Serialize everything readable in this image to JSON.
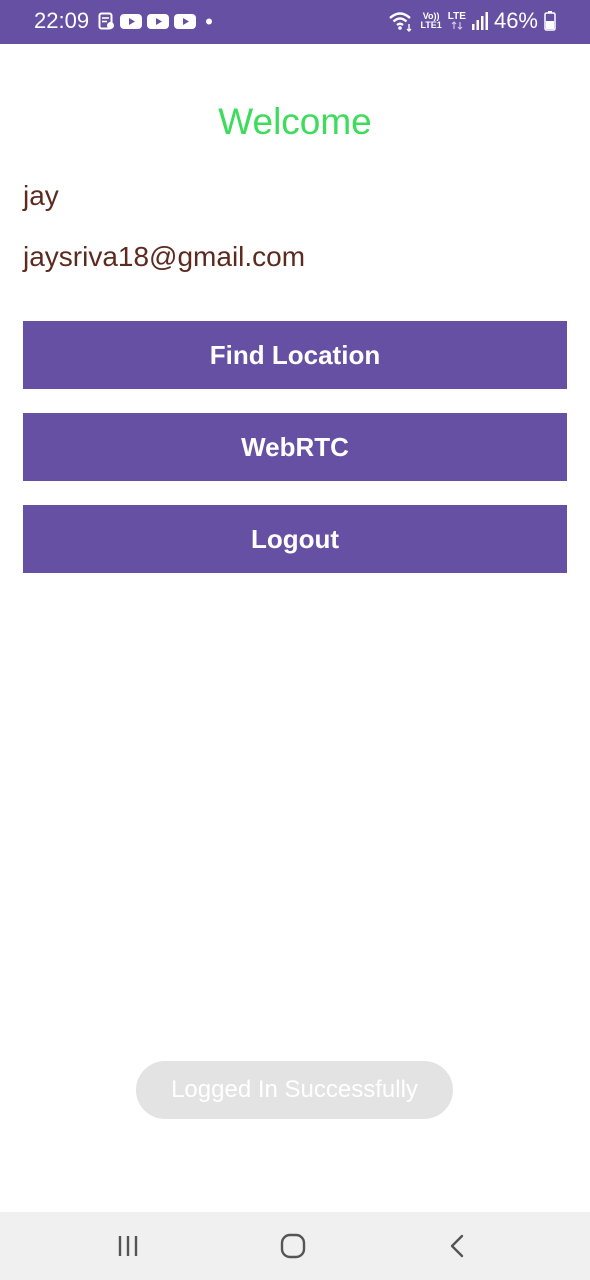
{
  "status_bar": {
    "time": "22:09",
    "network_top": "Vo))",
    "network_bottom": "LTE1",
    "lte_label": "LTE",
    "battery": "46%",
    "icons": [
      "notes-icon",
      "youtube-icon",
      "youtube-icon",
      "youtube-icon",
      "notification-dot-icon",
      "wifi-icon",
      "signal-icon",
      "battery-icon"
    ]
  },
  "main": {
    "welcome": "Welcome",
    "user_name": "jay",
    "user_email": "jaysriva18@gmail.com",
    "buttons": {
      "find_location": "Find Location",
      "webrtc": "WebRTC",
      "logout": "Logout"
    }
  },
  "toast": {
    "message": "Logged In Successfully"
  },
  "nav_bar": {
    "icons": [
      "recent-apps-icon",
      "home-icon",
      "back-icon"
    ]
  },
  "colors": {
    "primary": "#6650a4",
    "welcome_text": "#3ddc5b",
    "user_text": "#5d2a1e",
    "toast_bg": "#e3e3e3",
    "nav_bg": "#f0f0f0"
  }
}
